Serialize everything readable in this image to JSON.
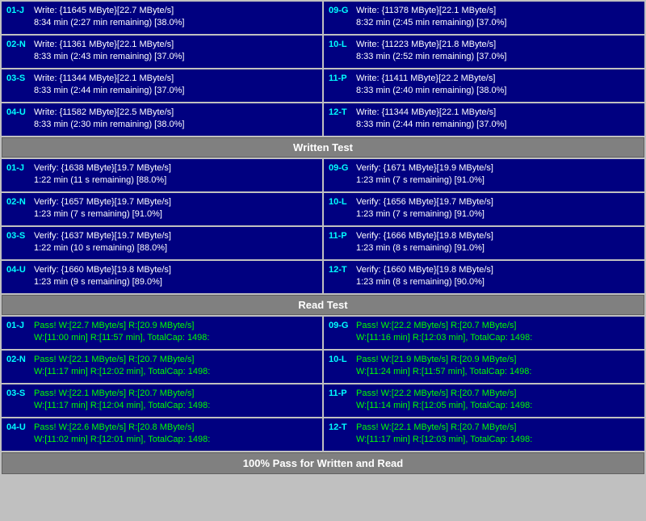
{
  "sections": {
    "write": {
      "rows_left": [
        {
          "id": "01-J",
          "line1": "Write: {11645 MByte}[22.7 MByte/s]",
          "line2": "8:34 min (2:27 min remaining)  [38.0%]"
        },
        {
          "id": "02-N",
          "line1": "Write: {11361 MByte}[22.1 MByte/s]",
          "line2": "8:33 min (2:43 min remaining)  [37.0%]"
        },
        {
          "id": "03-S",
          "line1": "Write: {11344 MByte}[22.1 MByte/s]",
          "line2": "8:33 min (2:44 min remaining)  [37.0%]"
        },
        {
          "id": "04-U",
          "line1": "Write: {11582 MByte}[22.5 MByte/s]",
          "line2": "8:33 min (2:30 min remaining)  [38.0%]"
        }
      ],
      "rows_right": [
        {
          "id": "09-G",
          "line1": "Write: {11378 MByte}[22.1 MByte/s]",
          "line2": "8:32 min (2:45 min remaining)  [37.0%]"
        },
        {
          "id": "10-L",
          "line1": "Write: {11223 MByte}[21.8 MByte/s]",
          "line2": "8:33 min (2:52 min remaining)  [37.0%]"
        },
        {
          "id": "11-P",
          "line1": "Write: {11411 MByte}[22.2 MByte/s]",
          "line2": "8:33 min (2:40 min remaining)  [38.0%]"
        },
        {
          "id": "12-T",
          "line1": "Write: {11344 MByte}[22.1 MByte/s]",
          "line2": "8:33 min (2:44 min remaining)  [37.0%]"
        }
      ],
      "header": "Written Test"
    },
    "verify": {
      "rows_left": [
        {
          "id": "01-J",
          "line1": "Verify: {1638 MByte}[19.7 MByte/s]",
          "line2": "1:22 min (11 s remaining)   [88.0%]"
        },
        {
          "id": "02-N",
          "line1": "Verify: {1657 MByte}[19.7 MByte/s]",
          "line2": "1:23 min (7 s remaining)   [91.0%]"
        },
        {
          "id": "03-S",
          "line1": "Verify: {1637 MByte}[19.7 MByte/s]",
          "line2": "1:22 min (10 s remaining)   [88.0%]"
        },
        {
          "id": "04-U",
          "line1": "Verify: {1660 MByte}[19.8 MByte/s]",
          "line2": "1:23 min (9 s remaining)   [89.0%]"
        }
      ],
      "rows_right": [
        {
          "id": "09-G",
          "line1": "Verify: {1671 MByte}[19.9 MByte/s]",
          "line2": "1:23 min (7 s remaining)   [91.0%]"
        },
        {
          "id": "10-L",
          "line1": "Verify: {1656 MByte}[19.7 MByte/s]",
          "line2": "1:23 min (7 s remaining)   [91.0%]"
        },
        {
          "id": "11-P",
          "line1": "Verify: {1666 MByte}[19.8 MByte/s]",
          "line2": "1:23 min (8 s remaining)   [91.0%]"
        },
        {
          "id": "12-T",
          "line1": "Verify: {1660 MByte}[19.8 MByte/s]",
          "line2": "1:23 min (8 s remaining)   [90.0%]"
        }
      ],
      "header": "Read Test"
    },
    "read": {
      "rows_left": [
        {
          "id": "01-J",
          "line1": "Pass! W:[22.7 MByte/s] R:[20.9 MByte/s]",
          "line2": "W:[11:00 min] R:[11:57 min], TotalCap: 1498:"
        },
        {
          "id": "02-N",
          "line1": "Pass! W:[22.1 MByte/s] R:[20.7 MByte/s]",
          "line2": "W:[11:17 min] R:[12:02 min], TotalCap: 1498:"
        },
        {
          "id": "03-S",
          "line1": "Pass! W:[22.1 MByte/s] R:[20.7 MByte/s]",
          "line2": "W:[11:17 min] R:[12:04 min], TotalCap: 1498:"
        },
        {
          "id": "04-U",
          "line1": "Pass! W:[22.6 MByte/s] R:[20.8 MByte/s]",
          "line2": "W:[11:02 min] R:[12:01 min], TotalCap: 1498:"
        }
      ],
      "rows_right": [
        {
          "id": "09-G",
          "line1": "Pass! W:[22.2 MByte/s] R:[20.7 MByte/s]",
          "line2": "W:[11:16 min] R:[12:03 min], TotalCap: 1498:"
        },
        {
          "id": "10-L",
          "line1": "Pass! W:[21.9 MByte/s] R:[20.9 MByte/s]",
          "line2": "W:[11:24 min] R:[11:57 min], TotalCap: 1498:"
        },
        {
          "id": "11-P",
          "line1": "Pass! W:[22.2 MByte/s] R:[20.7 MByte/s]",
          "line2": "W:[11:14 min] R:[12:05 min], TotalCap: 1498:"
        },
        {
          "id": "12-T",
          "line1": "Pass! W:[22.1 MByte/s] R:[20.7 MByte/s]",
          "line2": "W:[11:17 min] R:[12:03 min], TotalCap: 1498:"
        }
      ]
    }
  },
  "headers": {
    "written_test": "Written Test",
    "read_test": "Read Test",
    "bottom_bar": "100% Pass for Written and Read"
  }
}
